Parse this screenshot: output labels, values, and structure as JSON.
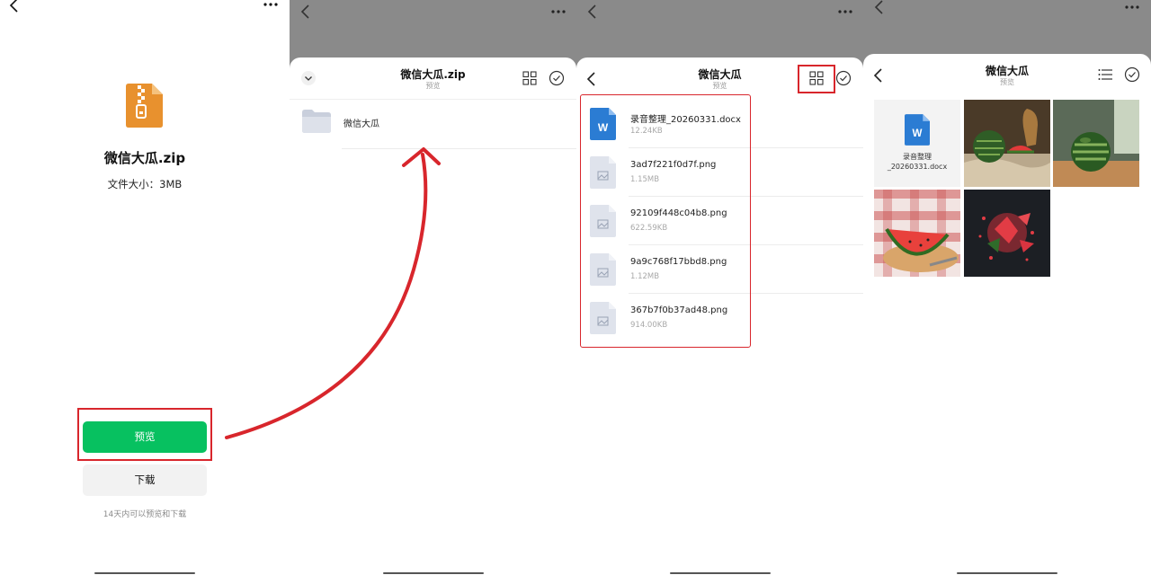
{
  "screen1": {
    "file_name": "微信大瓜.zip",
    "file_size": "文件大小：3MB",
    "preview_button": "预览",
    "download_button": "下载",
    "hint": "14天内可以预览和下载"
  },
  "screen2": {
    "title": "微信大瓜.zip",
    "subtitle": "预览",
    "folder_name": "微信大瓜"
  },
  "screen3": {
    "title": "微信大瓜",
    "subtitle": "预览",
    "files": [
      {
        "name": "录音整理_20260331.docx",
        "size": "12.24KB",
        "icon": "word-icon"
      },
      {
        "name": "3ad7f221f0d7f.png",
        "size": "1.15MB",
        "icon": "image-file-icon"
      },
      {
        "name": "92109f448c04b8.png",
        "size": "622.59KB",
        "icon": "image-file-icon"
      },
      {
        "name": "9a9c768f17bbd8.png",
        "size": "1.12MB",
        "icon": "image-file-icon"
      },
      {
        "name": "367b7f0b37ad48.png",
        "size": "914.00KB",
        "icon": "image-file-icon"
      }
    ]
  },
  "screen4": {
    "title": "微信大瓜",
    "subtitle": "预览",
    "doc_tile_line1": "录音整理",
    "doc_tile_line2": "_20260331.docx",
    "image_tiles": [
      "watermelon-still-life",
      "watermelon-on-table",
      "watermelon-slice-on-board",
      "watermelon-splash"
    ]
  },
  "colors": {
    "accent_green": "#07c160",
    "highlight_red": "#d8262c",
    "overlay_gray": "#8a8a8a",
    "word_blue": "#2b7cd3",
    "zip_orange": "#e8912e"
  }
}
